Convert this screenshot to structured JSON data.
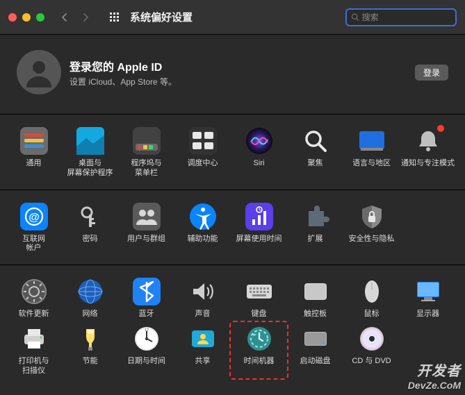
{
  "window": {
    "title": "系统偏好设置",
    "search_placeholder": "搜索"
  },
  "apple_id": {
    "heading": "登录您的 Apple ID",
    "subtext": "设置 iCloud、App Store 等。",
    "signin_label": "登录"
  },
  "sections": [
    {
      "items": [
        {
          "key": "general",
          "label": "通用",
          "icon": "general"
        },
        {
          "key": "desktop",
          "label": "桌面与\n屏幕保护程序",
          "icon": "desktop"
        },
        {
          "key": "dock",
          "label": "程序坞与\n菜单栏",
          "icon": "dock"
        },
        {
          "key": "mission-control",
          "label": "调度中心",
          "icon": "mission-control"
        },
        {
          "key": "siri",
          "label": "Siri",
          "icon": "siri"
        },
        {
          "key": "spotlight",
          "label": "聚焦",
          "icon": "spotlight"
        },
        {
          "key": "language",
          "label": "语言与地区",
          "icon": "language"
        },
        {
          "key": "notifications",
          "label": "通知与专注模式",
          "icon": "notifications",
          "badge": true
        }
      ]
    },
    {
      "items": [
        {
          "key": "internet-accounts",
          "label": "互联网\n帐户",
          "icon": "internet-accounts"
        },
        {
          "key": "passwords",
          "label": "密码",
          "icon": "passwords"
        },
        {
          "key": "users-groups",
          "label": "用户与群组",
          "icon": "users-groups"
        },
        {
          "key": "accessibility",
          "label": "辅助功能",
          "icon": "accessibility"
        },
        {
          "key": "screen-time",
          "label": "屏幕使用时间",
          "icon": "screen-time"
        },
        {
          "key": "extensions",
          "label": "扩展",
          "icon": "extensions"
        },
        {
          "key": "security",
          "label": "安全性与隐私",
          "icon": "security"
        }
      ]
    },
    {
      "items": [
        {
          "key": "software-update",
          "label": "软件更新",
          "icon": "software-update"
        },
        {
          "key": "network",
          "label": "网络",
          "icon": "network"
        },
        {
          "key": "bluetooth",
          "label": "蓝牙",
          "icon": "bluetooth"
        },
        {
          "key": "sound",
          "label": "声音",
          "icon": "sound"
        },
        {
          "key": "keyboard",
          "label": "键盘",
          "icon": "keyboard"
        },
        {
          "key": "trackpad",
          "label": "触控板",
          "icon": "trackpad"
        },
        {
          "key": "mouse",
          "label": "鼠标",
          "icon": "mouse"
        },
        {
          "key": "displays",
          "label": "显示器",
          "icon": "displays"
        },
        {
          "key": "printers",
          "label": "打印机与\n扫描仪",
          "icon": "printers"
        },
        {
          "key": "energy",
          "label": "节能",
          "icon": "energy"
        },
        {
          "key": "date-time",
          "label": "日期与时间",
          "icon": "date-time"
        },
        {
          "key": "sharing",
          "label": "共享",
          "icon": "sharing"
        },
        {
          "key": "time-machine",
          "label": "时间机器",
          "icon": "time-machine",
          "highlight": true
        },
        {
          "key": "startup-disk",
          "label": "启动磁盘",
          "icon": "startup-disk"
        },
        {
          "key": "cd-dvd",
          "label": "CD 与 DVD",
          "icon": "cd-dvd"
        }
      ]
    }
  ],
  "watermark": {
    "line1": "开发者",
    "line2": "DevZe.CoM"
  }
}
